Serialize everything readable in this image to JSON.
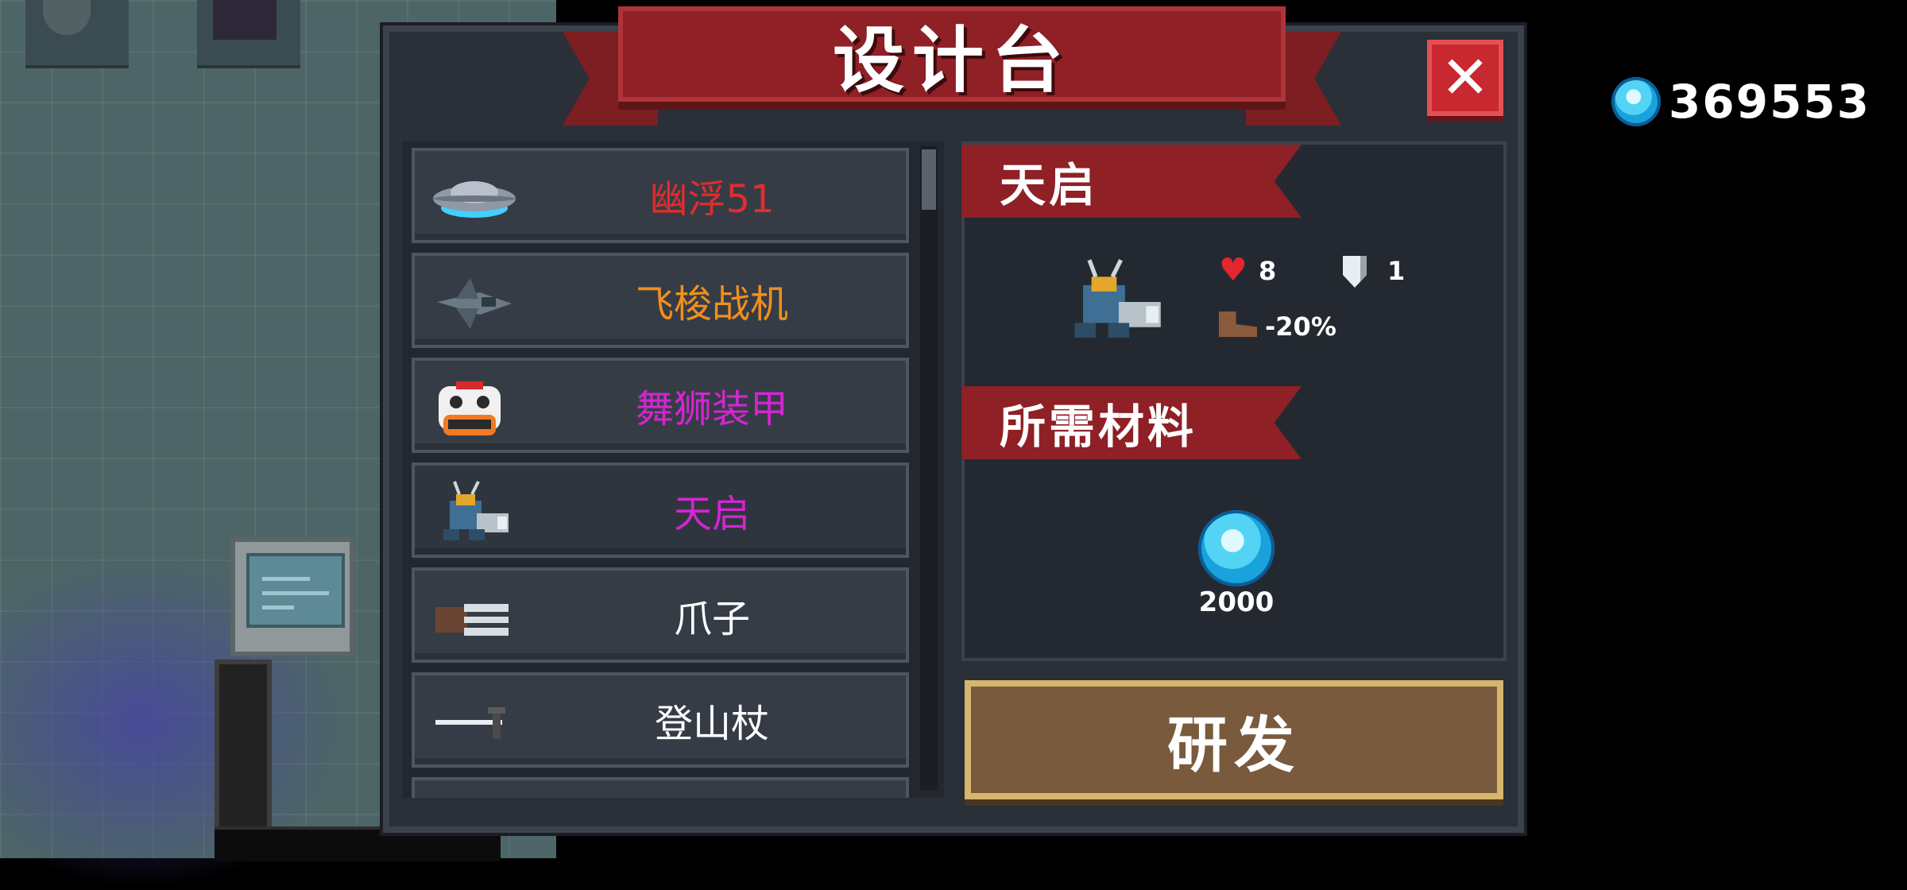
{
  "panel": {
    "title": "设计台",
    "close_icon": "close-icon"
  },
  "currency": {
    "icon": "gem-icon",
    "amount": "369553"
  },
  "list": {
    "items": [
      {
        "label": "幽浮51",
        "color": "#e02d2d",
        "icon": "ufo-icon"
      },
      {
        "label": "飞梭战机",
        "color": "#f0901c",
        "icon": "fighter-jet-icon"
      },
      {
        "label": "舞狮装甲",
        "color": "#d226d0",
        "icon": "lion-dance-mech-icon"
      },
      {
        "label": "天启",
        "color": "#d226d0",
        "icon": "apocalypse-mech-icon"
      },
      {
        "label": "爪子",
        "color": "#ffffff",
        "icon": "claw-icon"
      },
      {
        "label": "登山杖",
        "color": "#ffffff",
        "icon": "climbing-stick-icon"
      }
    ],
    "selected_index": 3
  },
  "detail": {
    "name": "天启",
    "health": "8",
    "armor": "1",
    "speed": "-20%",
    "materials_title": "所需材料",
    "material_amount": "2000"
  },
  "research_button": {
    "label": "研发"
  }
}
